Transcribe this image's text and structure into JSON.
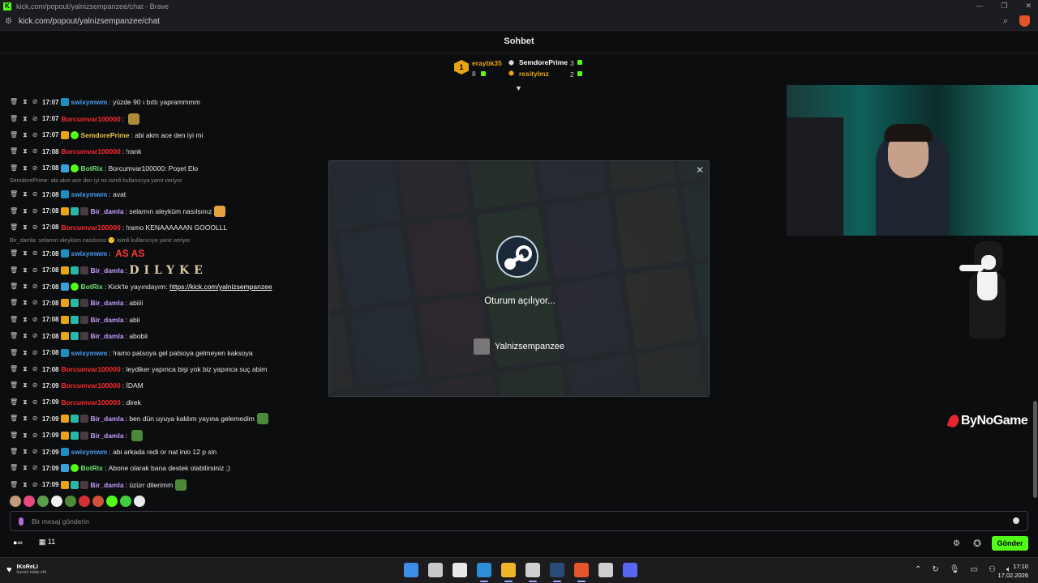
{
  "browser": {
    "window_title": "kick.com/popout/yalnizsempanzee/chat - Brave",
    "url": "kick.com/popout/yalnizsempanzee/chat"
  },
  "chat": {
    "header": "Sohbet",
    "leaderboard": [
      {
        "rank": "1",
        "user": "eraybk35",
        "count": "8"
      },
      {
        "user": "SemdorePrime",
        "count": "3"
      },
      {
        "user": "resitylmz",
        "count": "2"
      }
    ],
    "messages": [
      {
        "time": "17:07",
        "user": "swixymwm",
        "color": "#4a9cf0",
        "badges": [
          "b-cyan"
        ],
        "text": "yüzde 90 ı bıttı yaprammmm"
      },
      {
        "time": "17:07",
        "user": "Borcumvar100000",
        "color": "#ff2b2b",
        "badges": [],
        "text": "",
        "emote": "#b08a3a"
      },
      {
        "time": "17:07",
        "user": "SemdorePrime",
        "color": "#e8c34a",
        "badges": [
          "b-gold",
          "b-green"
        ],
        "text": "abi akm ace den iyi mi"
      },
      {
        "time": "17:08",
        "user": "Borcumvar100000",
        "color": "#ff2b2b",
        "badges": [],
        "text": "!rank"
      },
      {
        "time": "17:08",
        "user": "BotRix",
        "color": "#6ee36e",
        "badges": [
          "b-blue",
          "b-green"
        ],
        "text": "Borcumvar100000: Poşet Elo"
      },
      {
        "reply": "SemdorePrime: abi akm ace den iyi mi isimli kullanıcıya yanıt veriyor"
      },
      {
        "time": "17:08",
        "user": "swixymwm",
        "color": "#4a9cf0",
        "badges": [
          "b-cyan"
        ],
        "text": "avat"
      },
      {
        "time": "17:08",
        "user": "Bir_damla",
        "color": "#c79bff",
        "badges": [
          "b-gold",
          "b-teal",
          "b-dark"
        ],
        "text": "selamın aleyküm nasılsınız",
        "emote": "#e6a23c"
      },
      {
        "time": "17:08",
        "user": "Borcumvar100000",
        "color": "#ff2b2b",
        "badges": [],
        "text": "!ramo KENAAAAAAN GOOOLLL"
      },
      {
        "reply": "Bir_damla: selamın aleyküm nasılsınız 🙁 isimli kullanıcıya yanıt veriyor"
      },
      {
        "time": "17:08",
        "user": "swixymwm",
        "color": "#4a9cf0",
        "badges": [
          "b-cyan"
        ],
        "text": "",
        "red_text": "AS AS"
      },
      {
        "time": "17:08",
        "user": "Bir_damla",
        "color": "#c79bff",
        "badges": [
          "b-gold",
          "b-teal",
          "b-dark"
        ],
        "text": "",
        "big_text": "DILYKE"
      },
      {
        "time": "17:08",
        "user": "BotRix",
        "color": "#6ee36e",
        "badges": [
          "b-blue",
          "b-green"
        ],
        "text": "Kick'te yayındayım:",
        "link": "https://kick.com/yalnizsempanzee"
      },
      {
        "time": "17:08",
        "user": "Bir_damla",
        "color": "#c79bff",
        "badges": [
          "b-gold",
          "b-teal",
          "b-dark"
        ],
        "text": "abiiii"
      },
      {
        "time": "17:08",
        "user": "Bir_damla",
        "color": "#c79bff",
        "badges": [
          "b-gold",
          "b-teal",
          "b-dark"
        ],
        "text": "abii"
      },
      {
        "time": "17:08",
        "user": "Bir_damla",
        "color": "#c79bff",
        "badges": [
          "b-gold",
          "b-teal",
          "b-dark"
        ],
        "text": "abobii"
      },
      {
        "time": "17:08",
        "user": "swixymwm",
        "color": "#4a9cf0",
        "badges": [
          "b-cyan"
        ],
        "text": "!ramo patsoya gel patsoya gelmeyen kaksoya"
      },
      {
        "time": "17:08",
        "user": "Borcumvar100000",
        "color": "#ff2b2b",
        "badges": [],
        "text": "leydiker yapınca bişi yok biz yapınca suç abim"
      },
      {
        "time": "17:09",
        "user": "Borcumvar100000",
        "color": "#ff2b2b",
        "badges": [],
        "text": "İDAM"
      },
      {
        "time": "17:09",
        "user": "Borcumvar100000",
        "color": "#ff2b2b",
        "badges": [],
        "text": "direk"
      },
      {
        "time": "17:09",
        "user": "Bir_damla",
        "color": "#c79bff",
        "badges": [
          "b-gold",
          "b-teal",
          "b-dark"
        ],
        "text": "ben dün uyuya kaldım yayına gelemedim",
        "emote": "#4c8a3a"
      },
      {
        "time": "17:09",
        "user": "Bir_damla",
        "color": "#c79bff",
        "badges": [
          "b-gold",
          "b-teal",
          "b-dark"
        ],
        "text": "",
        "emote": "#4c8a3a"
      },
      {
        "time": "17:09",
        "user": "swixymwm",
        "color": "#4a9cf0",
        "badges": [
          "b-cyan"
        ],
        "text": "abi arkada redi or nat inio 12 p sin"
      },
      {
        "time": "17:09",
        "user": "BotRix",
        "color": "#6ee36e",
        "badges": [
          "b-blue",
          "b-green"
        ],
        "text": "Abone olarak bana destek olabilirsiniz ;)"
      },
      {
        "time": "17:09",
        "user": "Bir_damla",
        "color": "#c79bff",
        "badges": [
          "b-gold",
          "b-teal",
          "b-dark"
        ],
        "text": "üzürr dilerimm",
        "emote": "#4c8a3a"
      }
    ],
    "quick_emotes": [
      "#c49a7a",
      "#e84a7a",
      "#5aa04a",
      "#f0f0f0",
      "#4c8a3a",
      "#d23030",
      "#d0523a",
      "#53fc18",
      "#3fd03f",
      "#eaeaea"
    ],
    "input_placeholder": "Bir mesaj gönderin",
    "viewers": "11",
    "send_label": "Gönder"
  },
  "steam_modal": {
    "loading_text": "Oturum açılıyor...",
    "account": "Yalnizsempanzee"
  },
  "overlay": {
    "brand": "ByNoGame"
  },
  "taskbar": {
    "follow_user": "IKoReLI",
    "follow_sub": "kanalı takip etti",
    "apps": [
      "#3b8fe8",
      "#c9c9c9",
      "#e9e9e9",
      "#2c8fd6",
      "#f0b429",
      "#cfcfcf",
      "#2a4a7a",
      "#e5542a",
      "#cfcfcf",
      "#5865f2"
    ],
    "time": "17:10",
    "date": "17.02.2026"
  }
}
